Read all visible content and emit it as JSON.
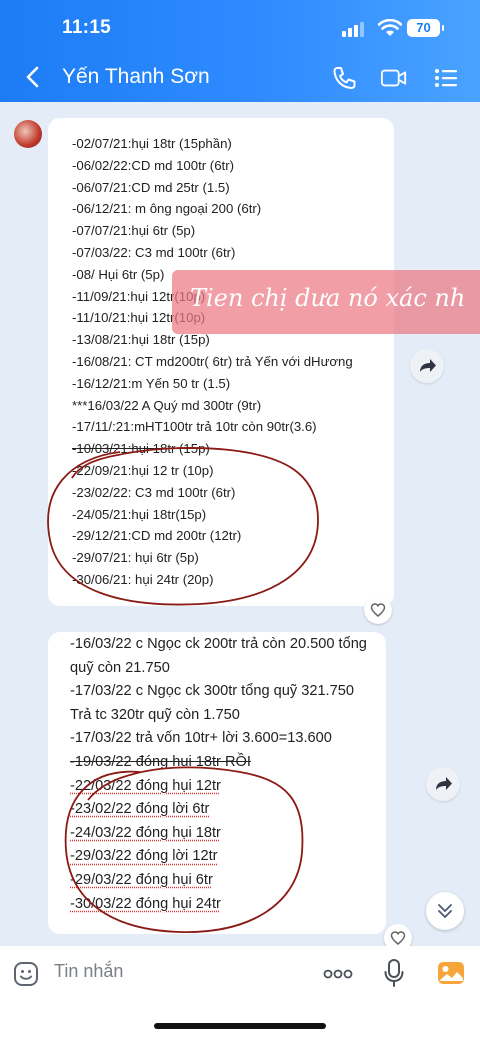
{
  "status": {
    "time": "11:15",
    "battery": "70"
  },
  "header": {
    "contact_name": "Yến Thanh Sơn"
  },
  "message1": {
    "lines": [
      "-02/07/21:hụi 18tr (15phần)",
      "-06/02/22:CD md 100tr (6tr)",
      "-06/07/21:CD md 25tr (1.5)",
      "-06/12/21: m ông ngoại 200 (6tr)",
      "-07/07/21:hụi 6tr (5p)",
      "-07/03/22: C3 md 100tr (6tr)",
      "-08/ Hụi 6tr (5p)",
      "-11/09/21:hụi 12tr(10p)",
      "-11/10/21:hụi 12tr(10p)",
      "-13/08/21:hụi 18tr (15p)",
      "-16/08/21: CT md200tr( 6tr) trả Yến với dHương",
      "-16/12/21:m Yến 50 tr (1.5)",
      "***16/03/22 A Quý md 300tr (9tr)",
      "-17/11/:21:mHT100tr trả 10tr còn 90tr(3.6)",
      "-10/03/21:hụi 18tr (15p)",
      "-22/09/21:hụi 12 tr (10p)",
      "-23/02/22: C3 md 100tr (6tr)",
      "-24/05/21:hụi 18tr(15p)",
      "-29/12/21:CD md 200tr (12tr)",
      "-29/07/21: hụi 6tr (5p)",
      "-30/06/21: hụi 24tr (20p)"
    ]
  },
  "overlay_caption": "Tien chị dưa nó xác nh",
  "message2": {
    "lines": [
      "-16/03/22 c Ngọc ck 200tr trả còn 20.500 tổng",
      "quỹ còn 21.750",
      "-17/03/22 c Ngọc ck 300tr tổng quỹ 321.750",
      "Trả tc 320tr quỹ còn 1.750",
      "-17/03/22 trả vốn 10tr+ lời 3.600=13.600",
      "-19/03/22 đóng hụi 18tr RỒI",
      "-22/03/22 đóng hụi 12tr",
      "-23/02/22 đóng lời 6tr",
      "-24/03/22 đóng hụi 18tr",
      "-29/03/22 đóng lời 12tr",
      "-29/03/22 đóng hụi 6tr",
      "-30/03/22 đóng hụi 24tr"
    ]
  },
  "input": {
    "placeholder": "Tin nhắn"
  },
  "icons": [
    "back-icon",
    "phone-icon",
    "video-call-icon",
    "menu-icon",
    "share-icon",
    "heart-icon",
    "chevron-down-icon",
    "sticker-icon",
    "more-icon",
    "microphone-icon",
    "image-icon"
  ],
  "colors": {
    "header": "#1d7cf5",
    "chat_bg": "#e3ecf7",
    "bubble": "#ffffff",
    "date_highlight": "#c9a227",
    "circle_ink": "#8b1a14"
  }
}
